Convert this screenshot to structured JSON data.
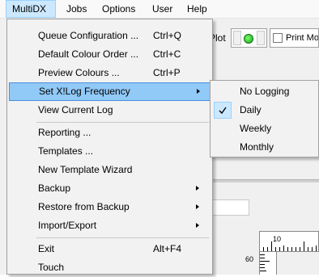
{
  "menubar": {
    "items": [
      {
        "label": "MultiDX"
      },
      {
        "label": "Jobs"
      },
      {
        "label": "Options"
      },
      {
        "label": "User"
      },
      {
        "label": "Help"
      }
    ]
  },
  "toolbar": {
    "plot_label": "Plot",
    "print_mode_label": "Print Mode"
  },
  "ruler": {
    "h_label": "10",
    "v_label": "60"
  },
  "menu": {
    "items": [
      {
        "label": "Queue Configuration ...",
        "shortcut": "Ctrl+Q"
      },
      {
        "label": "Default Colour Order ...",
        "shortcut": "Ctrl+C"
      },
      {
        "label": "Preview Colours ...",
        "shortcut": "Ctrl+P"
      },
      {
        "label": "Set X!Log Frequency",
        "shortcut": ""
      },
      {
        "label": "View Current Log",
        "shortcut": ""
      },
      {
        "label": "Reporting ...",
        "shortcut": ""
      },
      {
        "label": "Templates ...",
        "shortcut": ""
      },
      {
        "label": "New Template Wizard",
        "shortcut": ""
      },
      {
        "label": "Backup",
        "shortcut": ""
      },
      {
        "label": "Restore from Backup",
        "shortcut": ""
      },
      {
        "label": "Import/Export",
        "shortcut": ""
      },
      {
        "label": "Exit",
        "shortcut": "Alt+F4"
      },
      {
        "label": "Touch",
        "shortcut": ""
      }
    ]
  },
  "submenu": {
    "items": [
      {
        "label": "No Logging",
        "checked": false
      },
      {
        "label": "Daily",
        "checked": true
      },
      {
        "label": "Weekly",
        "checked": false
      },
      {
        "label": "Monthly",
        "checked": false
      }
    ]
  },
  "colors": {
    "highlight": "#91c9f7",
    "highlight_border": "#4a90d9",
    "menu_bg": "#f2f2f2",
    "led": "#22c022"
  }
}
